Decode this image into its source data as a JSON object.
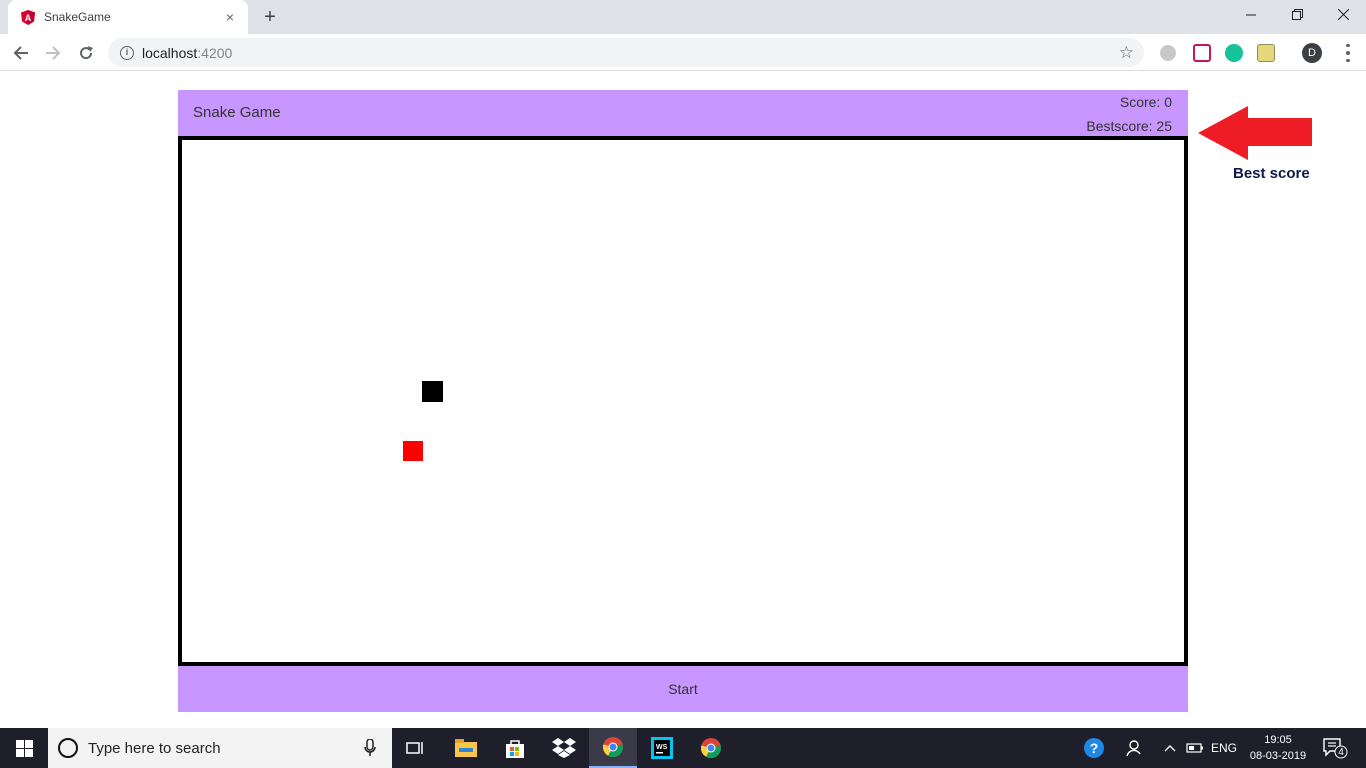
{
  "browser": {
    "tab_title": "SnakeGame",
    "tab_close": "×",
    "new_tab": "+",
    "url_host": "localhost",
    "url_port": ":4200",
    "avatar_letter": "D",
    "window_controls": {
      "minimize": "—",
      "maximize": "❐",
      "close": "✕"
    },
    "icons": [
      "angular-favicon-icon",
      "back-icon",
      "forward-icon",
      "reload-icon",
      "info-icon",
      "star-icon"
    ]
  },
  "game": {
    "title": "Snake Game",
    "score": "Score: 0",
    "bestscore": "Bestscore: 25",
    "start_label": "Start",
    "colors": {
      "header": "#c896ff",
      "snake": "#000000",
      "food": "#ff0000",
      "border": "#000000"
    }
  },
  "annotation": {
    "label": "Best score",
    "arrow_color": "#ee1c24"
  },
  "taskbar": {
    "search_placeholder": "Type here to search",
    "language": "ENG",
    "time": "19:05",
    "date": "08-03-2019",
    "notification_count": "4"
  }
}
